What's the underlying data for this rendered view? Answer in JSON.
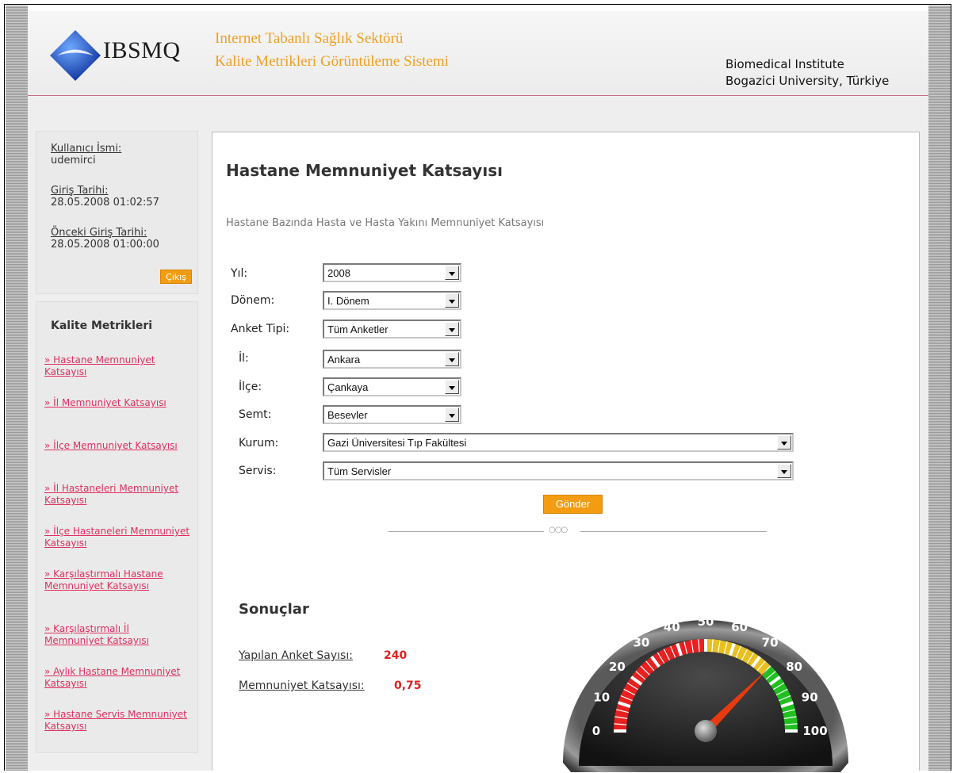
{
  "header": {
    "logo_text": "IBSMQ",
    "title_line1": "Internet Tabanlı Sağlık Sektörü",
    "title_line2": "Kalite Metrikleri Görüntüleme Sistemi",
    "institute_line1": "Biomedical Institute",
    "institute_line2": "Bogazici University, Türkiye"
  },
  "user": {
    "username_label": "Kullanıcı İsmi:",
    "username": "udemirci",
    "login_label": "Giriş Tarihi:",
    "login_date": "28.05.2008 01:02:57",
    "prev_login_label": "Önceki Giriş Tarihi:",
    "prev_login_date": "28.05.2008 01:00:00",
    "logout_label": "Çıkış"
  },
  "sidebar": {
    "title": "Kalite Metrikleri",
    "links": [
      "» Hastane Memnuniyet Katsayısı",
      "» İl Memnuniyet Katsayısı",
      "» İlçe Memnuniyet Katsayısı",
      "» İl Hastaneleri Memnuniyet Katsayısı",
      "» İlçe Hastaneleri Memnuniyet Katsayısı",
      "» Karşılaştırmalı Hastane Memnuniyet Katsayısı",
      "» Karşılaştırmalı İl Memnuniyet Katsayısı",
      "» Aylık Hastane Memnuniyet Katsayısı",
      "» Hastane Servis Memnuniyet Katsayısı"
    ]
  },
  "main": {
    "title": "Hastane Memnuniyet Katsayısı",
    "subtitle": "Hastane Bazında Hasta ve Hasta Yakını Memnuniyet Katsayısı",
    "form": {
      "year_label": "Yıl:",
      "year_value": "2008",
      "period_label": "Dönem:",
      "period_value": "I. Dönem",
      "survey_label": "Anket Tipi:",
      "survey_value": "Tüm Anketler",
      "city_label": "İl:",
      "city_value": "Ankara",
      "district_label": "İlçe:",
      "district_value": "Çankaya",
      "area_label": "Semt:",
      "area_value": "Besevler",
      "institution_label": "Kurum:",
      "institution_value": "Gazi Üniversitesi Tıp Fakültesi",
      "service_label": "Servis:",
      "service_value": "Tüm Servisler",
      "submit_label": "Gönder"
    },
    "divider_ornament": "○○○",
    "results": {
      "title": "Sonuçlar",
      "survey_count_label": "Yapılan Anket Sayısı:",
      "survey_count": "240",
      "satisfaction_label": "Memnuniyet Katsayısı:",
      "satisfaction": "0,75"
    }
  },
  "gauge": {
    "min": 0,
    "max": 100,
    "ticks": [
      "0",
      "10",
      "20",
      "30",
      "40",
      "50",
      "60",
      "70",
      "80",
      "90",
      "100"
    ],
    "value": 75,
    "bands": [
      {
        "from": 0,
        "to": 50,
        "color": "#e82020"
      },
      {
        "from": 50,
        "to": 75,
        "color": "#e8c020"
      },
      {
        "from": 75,
        "to": 100,
        "color": "#20c020"
      }
    ],
    "needle_color": "#e83a10"
  }
}
